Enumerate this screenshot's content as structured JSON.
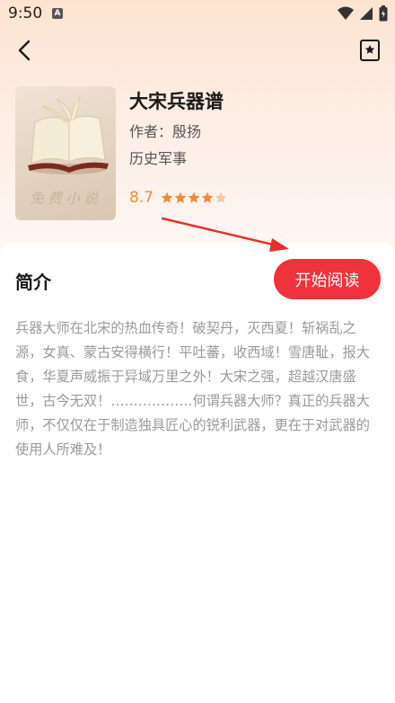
{
  "status_bar": {
    "time": "9:50",
    "notification_letter": "A"
  },
  "book": {
    "title": "大宋兵器谱",
    "author_label": "作者：",
    "author_name": "殷扬",
    "genre": "历史军事",
    "rating": "8.7",
    "stars_filled": 4,
    "stars_total": 5,
    "cover_text": "免费小说"
  },
  "intro": {
    "heading": "简介",
    "read_button": "开始阅读",
    "text": "兵器大师在北宋的热血传奇！破契丹，灭西夏！斩祸乱之源，女真、蒙古安得横行！平吐蕃，收西域！雪唐耻，报大食，华夏声威振于异域万里之外！大宋之强，超越汉唐盛世，古今无双！………………何谓兵器大师？真正的兵器大师，不仅仅在于制造独具匠心的锐利武器，更在于对武器的使用人所难及！"
  },
  "colors": {
    "accent": "#f0323c",
    "rating": "#f08a3c",
    "star_empty": "#f8c7a6"
  },
  "icons": [
    "back-arrow-icon",
    "bookmark-icon",
    "wifi-icon",
    "signal-icon",
    "battery-icon",
    "star-icon"
  ]
}
